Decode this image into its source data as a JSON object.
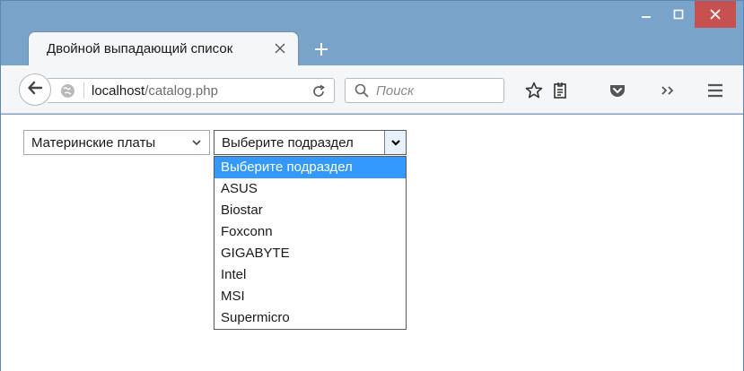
{
  "browser": {
    "tab": {
      "title": "Двойной выпадающий список"
    },
    "url": {
      "host": "localhost",
      "path": "/catalog.php"
    },
    "search": {
      "placeholder": "Поиск"
    }
  },
  "page": {
    "category_select": {
      "value": "Материнские платы"
    },
    "subcategory_select": {
      "value": "Выберите подраздел",
      "options": [
        "Выберите подраздел",
        "ASUS",
        "Biostar",
        "Foxconn",
        "GIGABYTE",
        "Intel",
        "MSI",
        "Supermicro"
      ],
      "highlighted_option": "Выберите подраздел"
    }
  },
  "colors": {
    "titlebar": "#7aa3c9",
    "close_button": "#c75050",
    "option_highlight": "#3399ff"
  },
  "icons": [
    "minimize-icon",
    "maximize-icon",
    "close-icon",
    "tab-close-icon",
    "new-tab-icon",
    "back-arrow-icon",
    "globe-icon",
    "reload-icon",
    "search-icon",
    "bookmark-star-icon",
    "reading-list-icon",
    "pocket-icon",
    "overflow-chevron-icon",
    "hamburger-menu-icon",
    "chevron-down-icon"
  ]
}
